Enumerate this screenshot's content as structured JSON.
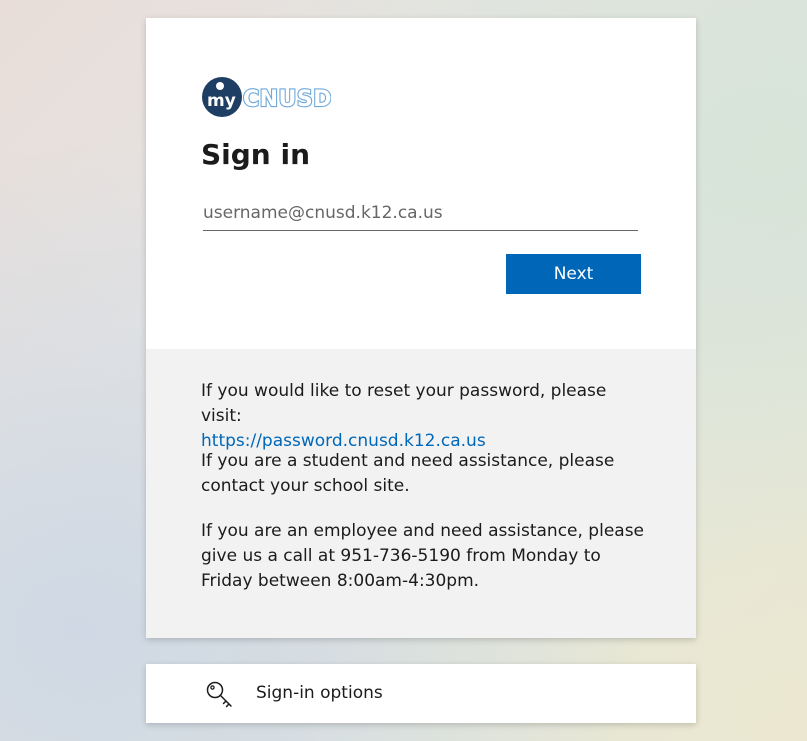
{
  "logo": {
    "text": "mycnusd",
    "colors": {
      "dark": "#1f3e63",
      "light": "#6fa8d8"
    }
  },
  "signin": {
    "title": "Sign in",
    "username_placeholder": "username@cnusd.k12.ca.us",
    "username_value": "",
    "next_label": "Next",
    "accent_color": "#0067b8"
  },
  "info": {
    "reset_text": "If you would like to reset your password, please visit:",
    "reset_link": "https://password.cnusd.k12.ca.us",
    "student_text": "If you are a student and need assistance, please contact your school site.",
    "employee_text": "If you are an employee and need assistance, please give us a call at 951-736-5190 from Monday to Friday between 8:00am-4:30pm."
  },
  "options": {
    "icon": "key-icon",
    "label": "Sign-in options"
  }
}
